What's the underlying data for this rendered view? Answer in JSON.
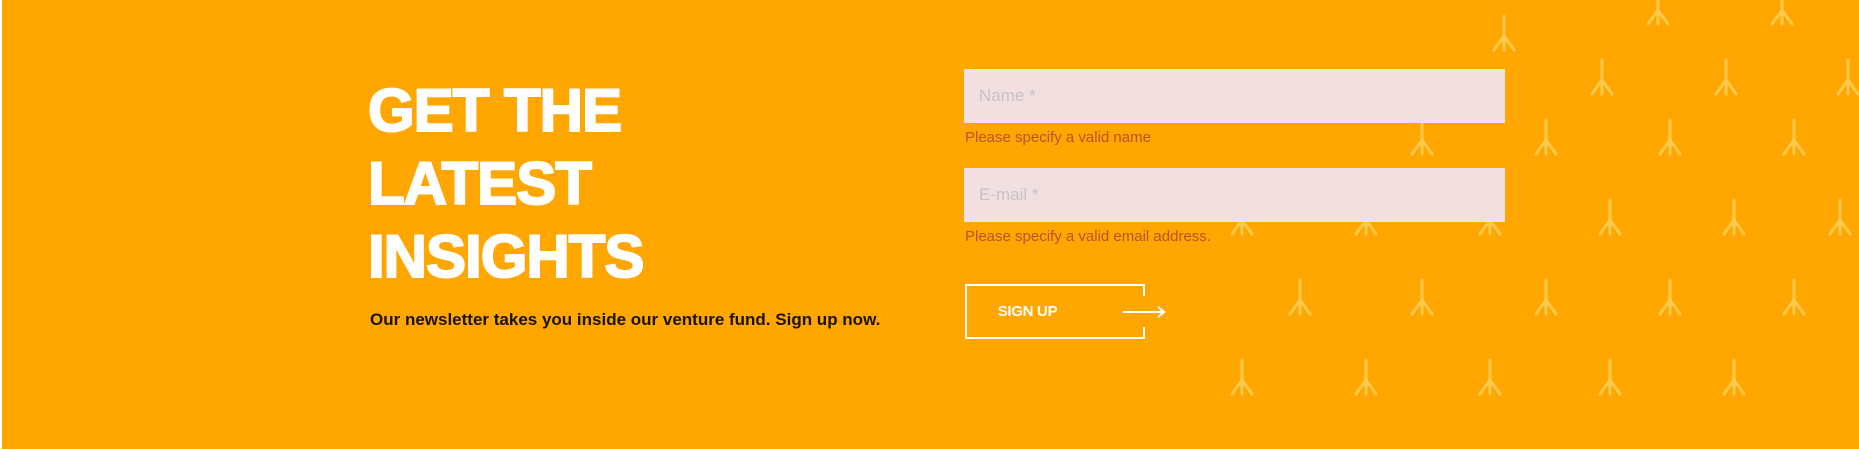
{
  "theme": {
    "background": "#FFA600",
    "text": "#FFFFFF",
    "input_background": "#F2DFE0",
    "error_text": "#B8542A",
    "pattern_color": "#FFC94D"
  },
  "newsletter": {
    "headline_lines": [
      "GET THE",
      "LATEST",
      "INSIGHTS"
    ],
    "tagline": "Our newsletter takes you inside our venture fund. Sign up now."
  },
  "form": {
    "name": {
      "placeholder": "Name *",
      "value": "",
      "error": "Please specify a valid name"
    },
    "email": {
      "placeholder": "E-mail *",
      "value": "",
      "error": "Please specify a valid email address."
    },
    "submit_label": "SIGN UP",
    "submit_icon": "arrow-right-icon"
  },
  "decoration": {
    "icon": "fork-glyph-icon"
  }
}
